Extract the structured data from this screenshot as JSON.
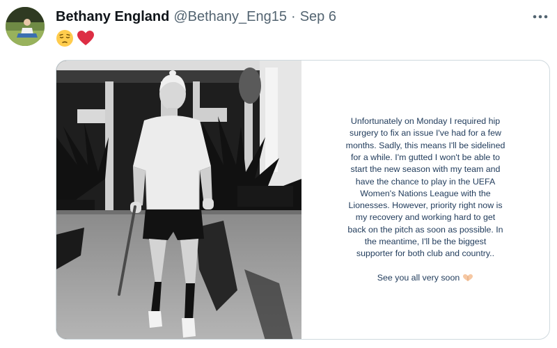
{
  "tweet": {
    "display_name": "Bethany England",
    "handle": "@Bethany_Eng15",
    "separator": "·",
    "date": "Sep 6",
    "emojis": [
      "pensive-face",
      "red-heart"
    ],
    "more_icon": "more-horizontal-icon",
    "avatar_icon": "profile-photo"
  },
  "media": {
    "photo": "black-and-white photo of a player on a crutch",
    "statement_lines": [
      "Unfortunately on Monday I required hip",
      "surgery to fix an issue I've had for a few",
      "months. Sadly, this means I'll be sidelined",
      "for a while. I'm gutted I won't be able to",
      "start the new season with my team and",
      "have the chance to play in the UEFA",
      "Women's Nations League with the",
      "Lionesses. However, priority right now is",
      "my recovery and working hard to get",
      "back on the pitch as soon as possible. In",
      "the meantime, I'll be the biggest",
      "supporter for both club and country.."
    ],
    "sign_off": "See you all very soon",
    "sign_off_icon": "heart-hands-icon"
  },
  "colors": {
    "name": "#0f1419",
    "secondary": "#536471",
    "statement_text": "#1f3a5a",
    "border": "#cfd9de"
  }
}
